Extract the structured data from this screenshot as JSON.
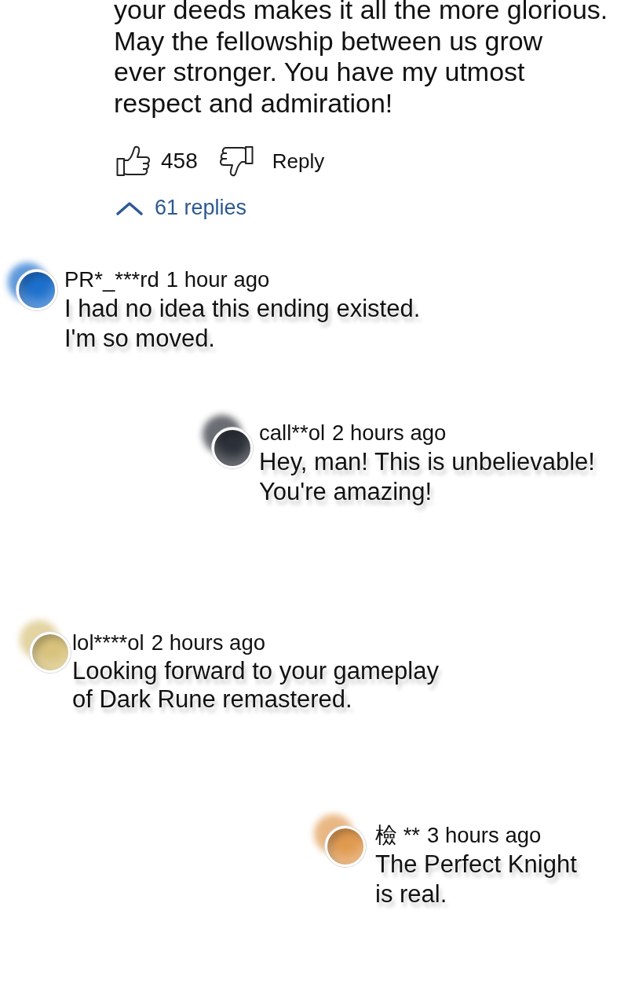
{
  "comment": {
    "text": "your deeds makes it all the more glorious.\nMay the fellowship between us grow\never stronger. You have my utmost\nrespect and admiration!",
    "likes": "458",
    "reply_label": "Reply",
    "replies": {
      "label": "61 replies",
      "expanded": true
    }
  },
  "floating_comments": [
    {
      "username": "PR*_***rd",
      "time": "1 hour ago",
      "text": "I had no idea this ending existed.\nI'm so moved.",
      "color": "#1c6fcc"
    },
    {
      "username": "call**ol",
      "time": "2 hours ago",
      "text": "Hey, man! This is unbelievable!\nYou're amazing!",
      "color": "#2c3038"
    },
    {
      "username": "lol****ol",
      "time": "2 hours ago",
      "text": "Looking forward to your gameplay\nof Dark Rune remastered.",
      "color": "#d8c27c"
    },
    {
      "username": "檢 **",
      "time": "3 hours ago",
      "text": "The Perfect Knight\nis real.",
      "color": "#e09a50"
    }
  ]
}
